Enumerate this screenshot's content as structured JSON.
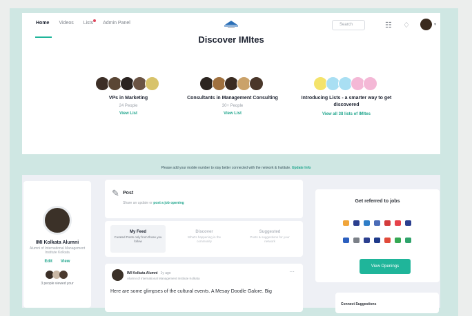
{
  "nav": {
    "items": [
      "Home",
      "Videos",
      "Lists",
      "Admin Panel"
    ]
  },
  "header": {
    "search_placeholder": "Search",
    "title": "Discover IMItes"
  },
  "groups": [
    {
      "name": "VPs in Marketing",
      "count": "24 People",
      "link": "View List",
      "faces": [
        "#3d2f27",
        "#5a4634",
        "#2a2320",
        "#6b5444",
        "#d8c36a"
      ]
    },
    {
      "name": "Consultants in Management Consulting",
      "count": "30+ People",
      "link": "View List",
      "faces": [
        "#2c2520",
        "#a0713f",
        "#3b2c22",
        "#caa26a",
        "#4a372a"
      ]
    },
    {
      "name": "Introducing Lists - a smarter way to get discovered",
      "count": "",
      "link": "View all 38 lists of IMItes",
      "faces": [
        "#f4e36b",
        "#a9dff3",
        "#a9dff3",
        "#f4b8d6",
        "#f4b8d6"
      ]
    }
  ],
  "banner": {
    "text": "Please add your mobile number to stay better connected with the network & Institute.",
    "link": "Update Info"
  },
  "profile": {
    "name": "IMI Kolkata Alumni",
    "subtitle": "Alumni of International Management Institute Kolkata",
    "edit": "Edit",
    "view": "View",
    "viewed_text": "3 people viewed your",
    "faces": [
      "#3a2e26",
      "#c9b8a6",
      "#4a3a2e"
    ]
  },
  "post": {
    "label": "Post",
    "prompt": "Share an update or ",
    "prompt_link": "post a job opening"
  },
  "feed_tabs": [
    {
      "title": "My Feed",
      "desc": "Curated Posts only from those you follow"
    },
    {
      "title": "Discover",
      "desc": "What's happening in the community"
    },
    {
      "title": "Suggested",
      "desc": "Posts & suggestions for your network"
    }
  ],
  "feed_post": {
    "author": "IMI Kolkata Alumni",
    "time": "1y ago",
    "org": "Alumni of International Management Institute Kolkata",
    "text": "Here are some glimpses of the cultural events. A Mesay Doodle Galore. Big"
  },
  "referral": {
    "title": "Get referred to jobs",
    "button": "View Openings",
    "logos_row1": [
      "#f0a53b",
      "#2b3f8f",
      "#2f7ec7",
      "#4b6cb7",
      "#d33b3b",
      "#e6424a",
      "#2b3f8f"
    ],
    "logos_row2": [
      "#2b5fbf",
      "#7b8088",
      "#2b3f8f",
      "#1e3a8a",
      "#e04a3a",
      "#35a853",
      "#2fa36b"
    ]
  },
  "connect": {
    "label": "Connect Suggestions"
  }
}
